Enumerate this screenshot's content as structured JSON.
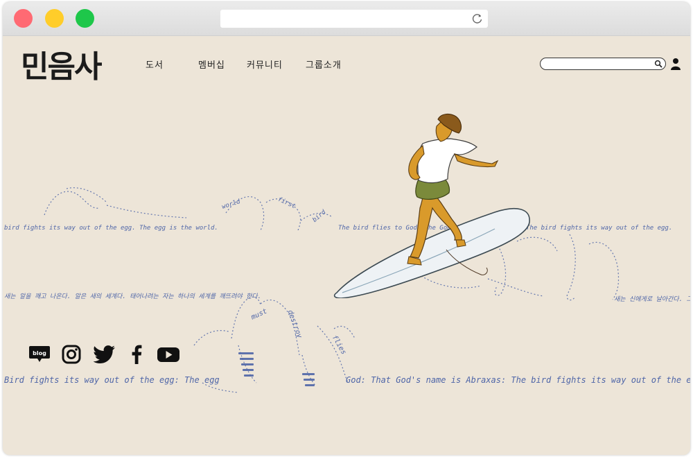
{
  "browser": {
    "url": "",
    "traffic_lights": {
      "close": "#ff6a73",
      "minimize": "#ffcd2a",
      "maximize": "#1ec74a"
    }
  },
  "header": {
    "logo": "민음사",
    "nav": [
      "도서",
      "멤버십",
      "커뮤니티",
      "그룹소개"
    ],
    "search_placeholder": ""
  },
  "scribbles": {
    "line1_left": "bird fights its way out of the egg. The egg is the world.",
    "line1_right": "The bird flies to God. The God's name is Abraxas. The bird fights its way out of the egg.",
    "line2_left": "새는 알을 깨고 나온다. 알은 새의 세계다. 태어나려는 자는 하나의 세계를 깨뜨려야 한다.",
    "line2_right": "새는 신에게로 날아간다. 그 신의 이름은 아브락사스.",
    "line3_left": "Bird fights its way out of the egg: The egg",
    "line3_right": "God: That God's name is Abraxas: The bird fights its way out of the egg:",
    "wave_words": [
      "world",
      "must",
      "first",
      "destroy",
      "bird",
      "flies"
    ]
  },
  "social": [
    "blog-icon",
    "instagram-icon",
    "twitter-icon",
    "facebook-icon",
    "youtube-icon"
  ],
  "social_blog_label": "blog",
  "colors": {
    "background": "#ede5d8",
    "scribble": "#4f66a8",
    "text": "#1b1b1b"
  }
}
